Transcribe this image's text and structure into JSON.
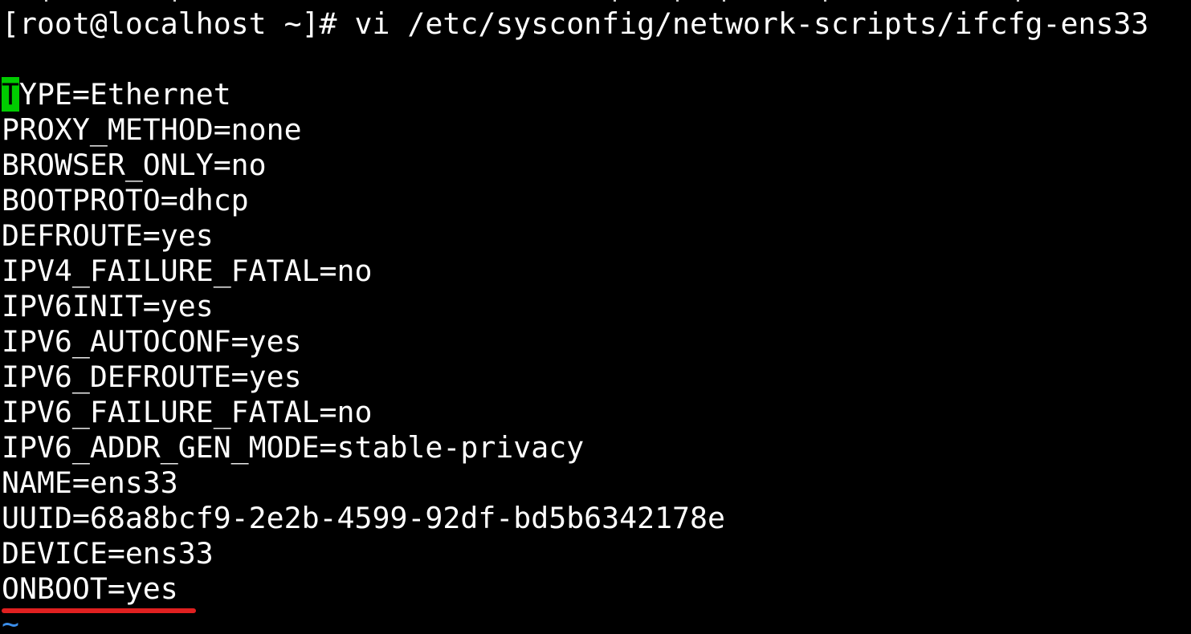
{
  "prompt": {
    "text": "[root@localhost ~]# vi /etc/sysconfig/network-scripts/ifcfg-ens33"
  },
  "editor": {
    "cursor_char": "T",
    "lines": [
      "YPE=Ethernet",
      "PROXY_METHOD=none",
      "BROWSER_ONLY=no",
      "BOOTPROTO=dhcp",
      "DEFROUTE=yes",
      "IPV4_FAILURE_FATAL=no",
      "IPV6INIT=yes",
      "IPV6_AUTOCONF=yes",
      "IPV6_DEFROUTE=yes",
      "IPV6_FAILURE_FATAL=no",
      "IPV6_ADDR_GEN_MODE=stable-privacy",
      "NAME=ens33",
      "UUID=68a8bcf9-2e2b-4599-92df-bd5b6342178e",
      "DEVICE=ens33",
      "ONBOOT=yes"
    ],
    "empty_line_marker": "~"
  },
  "colors": {
    "background": "#000000",
    "text": "#ffffff",
    "cursor": "#00cc00",
    "tilde": "#3b8eea",
    "highlight_underline": "#e02020"
  }
}
